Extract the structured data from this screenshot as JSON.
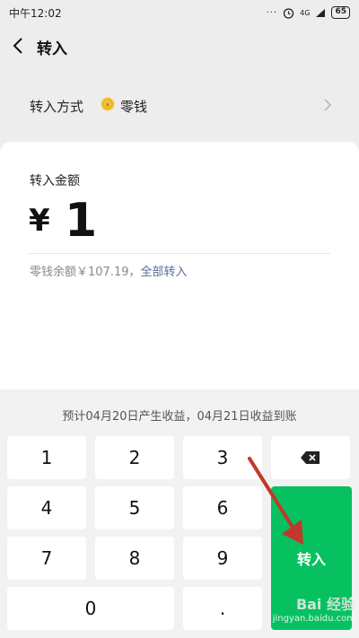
{
  "status_bar": {
    "time": "中午12:02",
    "dots": "···",
    "network": "4G",
    "battery": "65"
  },
  "header": {
    "title": "转入"
  },
  "method": {
    "label": "转入方式",
    "value": "零钱",
    "icon": "coin-icon"
  },
  "amount": {
    "label": "转入金额",
    "currency": "¥",
    "value": "1",
    "balance_text": "零钱余额￥107.19，",
    "withdraw_all": "全部转入"
  },
  "keypad": {
    "hint": "预计04月20日产生收益，04月21日收益到账",
    "keys": [
      "1",
      "2",
      "3",
      "4",
      "5",
      "6",
      "7",
      "8",
      "9",
      "0",
      "."
    ],
    "confirm_label": "转入",
    "delete_icon": "backspace-icon"
  },
  "colors": {
    "accent": "#07c160",
    "link": "#576b95",
    "annotation": "#c0392b"
  },
  "watermark": {
    "brand": "Bai 经验",
    "url": "jingyan.baidu.com"
  }
}
